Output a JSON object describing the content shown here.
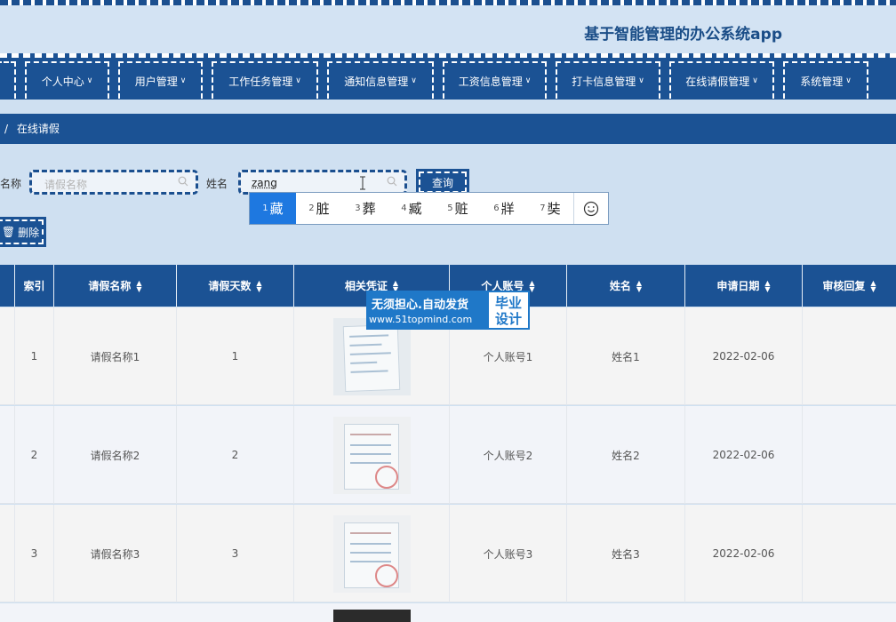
{
  "app": {
    "title": "基于智能管理的办公系统app"
  },
  "nav": {
    "items": [
      {
        "label": "个人中心"
      },
      {
        "label": "用户管理"
      },
      {
        "label": "工作任务管理"
      },
      {
        "label": "通知信息管理"
      },
      {
        "label": "工资信息管理"
      },
      {
        "label": "打卡信息管理"
      },
      {
        "label": "在线请假管理"
      },
      {
        "label": "系统管理"
      }
    ]
  },
  "breadcrumb": {
    "separator": "/",
    "current": "在线请假"
  },
  "search": {
    "leave_name_label": "名称",
    "leave_name_placeholder": "请假名称",
    "name_label": "姓名",
    "name_value": "zang",
    "query_button": "查询",
    "delete_button": "删除"
  },
  "ime": {
    "candidates": [
      {
        "n": "1",
        "text": "藏"
      },
      {
        "n": "2",
        "text": "脏"
      },
      {
        "n": "3",
        "text": "葬"
      },
      {
        "n": "4",
        "text": "臧"
      },
      {
        "n": "5",
        "text": "赃"
      },
      {
        "n": "6",
        "text": "牂"
      },
      {
        "n": "7",
        "text": "奘"
      }
    ]
  },
  "table": {
    "columns": [
      "索引",
      "请假名称",
      "请假天数",
      "相关凭证",
      "个人账号",
      "姓名",
      "申请日期",
      "审核回复"
    ],
    "rows": [
      {
        "index": "1",
        "leave_name": "请假名称1",
        "days": "1",
        "account": "个人账号1",
        "name": "姓名1",
        "date": "2022-02-06"
      },
      {
        "index": "2",
        "leave_name": "请假名称2",
        "days": "2",
        "account": "个人账号2",
        "name": "姓名2",
        "date": "2022-02-06"
      },
      {
        "index": "3",
        "leave_name": "请假名称3",
        "days": "3",
        "account": "个人账号3",
        "name": "姓名3",
        "date": "2022-02-06"
      }
    ]
  },
  "watermark": {
    "line1": "无须担心.自动发货",
    "line2": "www.51topmind.com",
    "badge1": "毕业",
    "badge2": "设计"
  },
  "colors": {
    "primary": "#1b5294",
    "background": "#cfe0f1",
    "ime_selected": "#1e78e0"
  }
}
